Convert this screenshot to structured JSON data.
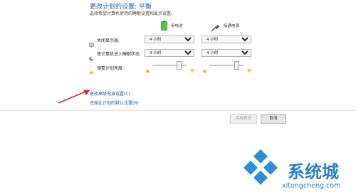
{
  "header": {
    "title": "更改计划的设置: 平衡",
    "subtitle": "选择希望计算机使用的睡眠设置和显示设置。"
  },
  "columns": {
    "battery": "用电池",
    "plugged": "接通电源"
  },
  "rows": [
    {
      "label": "关闭显示器:",
      "battery_value": "4 小时",
      "plugged_value": "4 小时"
    },
    {
      "label": "使计算机进入睡眠状态:",
      "battery_value": "4 小时",
      "plugged_value": "4 小时"
    }
  ],
  "brightness": {
    "label": "调整计划亮度:",
    "battery_level": 0.82,
    "plugged_level": 0.86
  },
  "links": {
    "advanced": "更改高级电源设置(C)",
    "restore": "还原此计划的默认设置(R)"
  },
  "buttons": {
    "save": "保存修改",
    "cancel": "取消"
  },
  "watermark": {
    "brand": "系统城",
    "url": "xitongcheng.com"
  },
  "colors": {
    "accent": "#1f5ba5",
    "annotation_arrow": "#d9272e"
  }
}
